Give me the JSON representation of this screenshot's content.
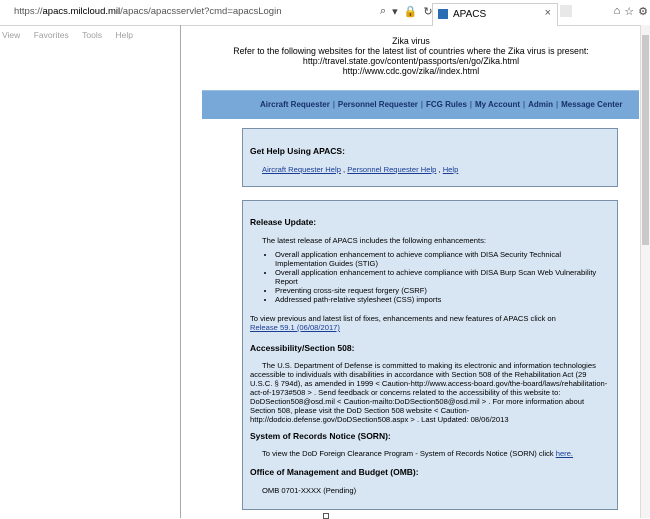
{
  "browser": {
    "url_prefix": "https://",
    "url_domain": "apacs.milcloud.mil",
    "url_path": "/apacs/apacsservlet?cmd=apacsLogin",
    "tab_title": "APACS",
    "tab_close": "×",
    "menu": [
      "View",
      "Favorites",
      "Tools",
      "Help"
    ]
  },
  "notice": {
    "line1": "Zika virus",
    "line2": "Refer to the following websites for the latest list of countries where the Zika virus is present:",
    "line3": "http://travel.state.gov/content/passports/en/go/Zika.html",
    "line4": "http://www.cdc.gov/zika//index.html"
  },
  "nav": {
    "items": [
      "Aircraft Requester",
      "Personnel Requester",
      "FCG Rules",
      "My Account",
      "Admin",
      "Message Center"
    ],
    "sep": "|"
  },
  "help": {
    "title": "Get Help Using APACS:",
    "links": [
      "Aircraft Requester Help",
      "Personnel Requester Help",
      "Help"
    ],
    "link_sep": " , "
  },
  "release": {
    "title": "Release Update:",
    "intro": "The latest release of APACS includes the following enhancements:",
    "items": [
      "Overall application enhancement to achieve compliance with DISA Security Technical Implementation Guides (STIG)",
      "Overall application enhancement to achieve compliance with DISA Burp Scan Web Vulnerability Report",
      "Preventing cross-site request forgery (CSRF)",
      "Addressed path-relative stylesheet (CSS) imports"
    ],
    "fixes_text": "To view previous and latest list of fixes, enhancements and new features of APACS click on",
    "fixes_link": "Release 59.1 (06/08/2017)"
  },
  "accessibility": {
    "title": "Accessibility/Section 508:",
    "body": "The U.S. Department of Defense is committed to making its electronic and information technologies accessible to individuals with disabilities in accordance with Section 508 of the Rehabilitation Act (29 U.S.C. § 794d), as amended in 1999 < Caution-http://www.access-board.gov/the-board/laws/rehabilitation-act-of-1973#508 > . Send feedback or concerns related to the accessibility of this website to: DoDSection508@osd.mil < Caution-mailto:DoDSection508@osd.mil > . For more information about Section 508, please visit the DoD Section 508 website < Caution-http://dodcio.defense.gov/DoDSection508.aspx > . Last Updated: 08/06/2013"
  },
  "sorn": {
    "title": "System of Records Notice (SORN):",
    "text": "To view the DoD Foreign Clearance Program - System of Records Notice (SORN) click",
    "link": "here."
  },
  "omb": {
    "title": "Office of Management and Budget (OMB):",
    "text": "OMB 0701-XXXX (Pending)"
  }
}
